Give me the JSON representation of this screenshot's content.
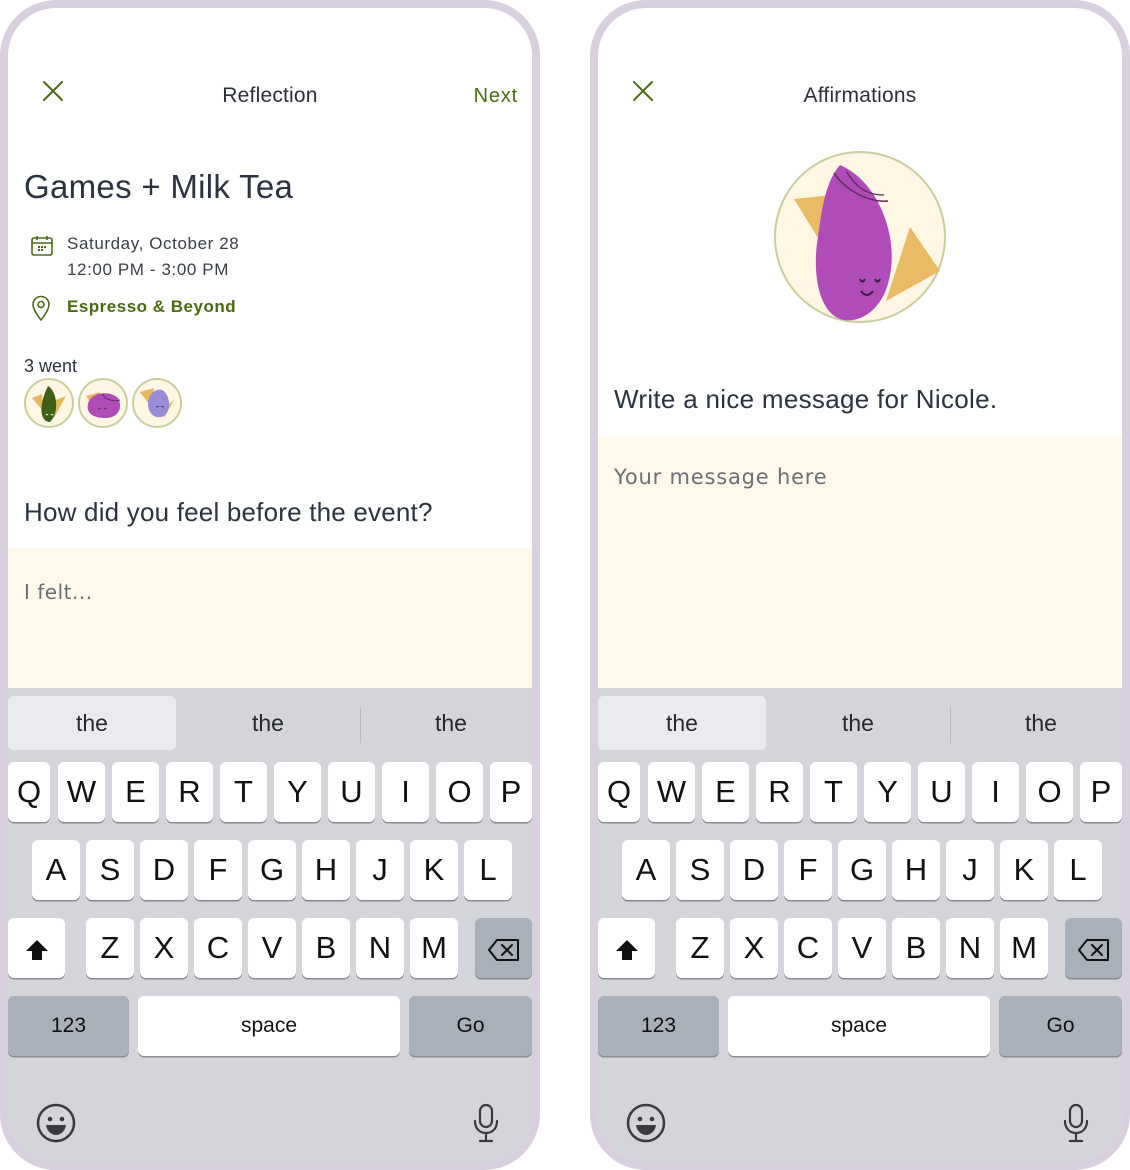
{
  "left_screen": {
    "header": {
      "title": "Reflection",
      "next_label": "Next",
      "close_icon": "close-icon"
    },
    "event": {
      "title": "Games + Milk Tea",
      "date": "Saturday, October 28",
      "time": "12:00 PM - 3:00 PM",
      "location": "Espresso & Beyond",
      "attendance": "3 went",
      "attendees": [
        {
          "avatar": "green-seed-avatar",
          "color": "#3f5f16"
        },
        {
          "avatar": "magenta-seed-avatar",
          "color": "#b14bb8"
        },
        {
          "avatar": "lavender-seed-avatar",
          "color": "#9a8bd6"
        }
      ]
    },
    "question": "How did you feel before the event?",
    "answer": {
      "value": "",
      "placeholder": "I felt..."
    }
  },
  "right_screen": {
    "header": {
      "title": "Affirmations",
      "close_icon": "close-icon"
    },
    "avatar": "magenta-seed-avatar",
    "prompt": "Write a nice message for Nicole.",
    "message": {
      "value": "",
      "placeholder": "Your message here"
    }
  },
  "keyboard": {
    "suggestions": [
      "the",
      "the",
      "the"
    ],
    "rows": [
      [
        "Q",
        "W",
        "E",
        "R",
        "T",
        "Y",
        "U",
        "I",
        "O",
        "P"
      ],
      [
        "A",
        "S",
        "D",
        "F",
        "G",
        "H",
        "J",
        "K",
        "L"
      ],
      [
        "Z",
        "X",
        "C",
        "V",
        "B",
        "N",
        "M"
      ]
    ],
    "numbers_label": "123",
    "space_label": "space",
    "go_label": "Go",
    "icons": [
      "shift-icon",
      "backspace-icon",
      "emoji-icon",
      "microphone-icon"
    ]
  },
  "colors": {
    "accent_green": "#4b6a12",
    "input_background": "#fff9eb",
    "phone_frame": "#d9d0df",
    "keyboard_background": "#d3d5da"
  }
}
